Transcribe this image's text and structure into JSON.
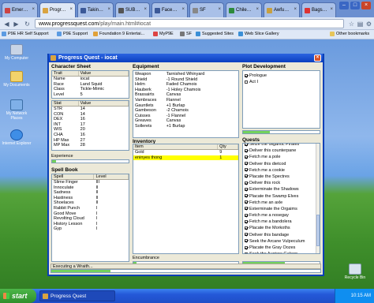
{
  "browser": {
    "tabs": [
      {
        "label": "Emer…"
      },
      {
        "label": "Progr…"
      },
      {
        "label": "Takin…"
      },
      {
        "label": "SUB…"
      },
      {
        "label": "Face…"
      },
      {
        "label": "SF"
      },
      {
        "label": "Chile…"
      },
      {
        "label": "Awfu…"
      },
      {
        "label": "Bags…"
      }
    ],
    "url_domain": "www.progressquest.com",
    "url_path": "/play/main.html#iocat",
    "bookmarks": [
      "P9E HR Self Support",
      "P9E Support",
      "Foundation 9 Entertai...",
      "MyP9E",
      "SF",
      "Suggested Sites",
      "Web Slice Gallery"
    ],
    "other_bookmarks": "Other bookmarks"
  },
  "desktop": {
    "icons": [
      "My Computer",
      "My Documents",
      "My Network Places",
      "Internet Explorer",
      "Recycle Bin"
    ]
  },
  "pq": {
    "title": "Progress Quest - iocat",
    "character_sheet": {
      "label": "Character Sheet",
      "trait_headers": [
        "Trait",
        "Value"
      ],
      "traits": [
        [
          "Name",
          "iocat"
        ],
        [
          "Race",
          "Land Squid"
        ],
        [
          "Class",
          "Tickle-Mimic"
        ],
        [
          "Level",
          "5"
        ]
      ],
      "stat_headers": [
        "Stat",
        "Value"
      ],
      "stats": [
        [
          "STR",
          "14"
        ],
        [
          "CON",
          "14"
        ],
        [
          "DEX",
          "16"
        ],
        [
          "INT",
          "17"
        ],
        [
          "WIS",
          "20"
        ],
        [
          "CHA",
          "16"
        ],
        [
          "HP Max",
          "27"
        ],
        [
          "MP Max",
          "28"
        ]
      ],
      "experience_label": "Experience",
      "experience_fraction": 0.05
    },
    "spell_book": {
      "label": "Spell Book",
      "headers": [
        "Spell",
        "Level"
      ],
      "spells": [
        [
          "Slime Finger",
          "III"
        ],
        [
          "Innoculate",
          "II"
        ],
        [
          "Sadness",
          "II"
        ],
        [
          "Hastiness",
          "II"
        ],
        [
          "Shoelaces",
          "II"
        ],
        [
          "Rabbit Punch",
          "I"
        ],
        [
          "Good Move",
          "I"
        ],
        [
          "Revolting Cloud",
          "I"
        ],
        [
          "History Lesson",
          "I"
        ],
        [
          "Gyp",
          "I"
        ]
      ]
    },
    "equipment": {
      "label": "Equipment",
      "items": [
        [
          "Weapon",
          "Tarnished Whinyard"
        ],
        [
          "Shield",
          "-1 Round Shield"
        ],
        [
          "Helm",
          "Faded Chamois"
        ],
        [
          "Hauberk",
          "-1 Holey Chamois"
        ],
        [
          "Brassairts",
          "Canvas"
        ],
        [
          "Vambraces",
          "Flannel"
        ],
        [
          "Gauntlets",
          "+1 Burlap"
        ],
        [
          "Gambeson",
          "-2 Chamois"
        ],
        [
          "Cuisses",
          "-1 Flannel"
        ],
        [
          "Greaves",
          "Canvas"
        ],
        [
          "Sollerets",
          "+1 Burlap"
        ]
      ]
    },
    "inventory": {
      "label": "Inventory",
      "headers": [
        "Item",
        "Qty"
      ],
      "items": [
        [
          "Gold",
          "9"
        ],
        [
          "eninyes thong",
          "1"
        ]
      ],
      "encumbrance_label": "Encumbrance",
      "encumbrance_fraction": 0.03
    },
    "plot": {
      "label": "Plot Development",
      "items": [
        {
          "label": "Prologue",
          "checked": true
        },
        {
          "label": "Act I",
          "checked": false
        }
      ],
      "progress_fraction": 0.35
    },
    "quests": {
      "label": "Quests",
      "items": [
        {
          "label": "Seize the Gigantic Pirates",
          "checked": true
        },
        {
          "label": "Deliver this counterpane",
          "checked": true
        },
        {
          "label": "Fetch me a pole",
          "checked": true
        },
        {
          "label": "Deliver this dietcod",
          "checked": true
        },
        {
          "label": "Fetch me a cookie",
          "checked": true
        },
        {
          "label": "Placate the Spectres",
          "checked": true
        },
        {
          "label": "Deliver this rock",
          "checked": true
        },
        {
          "label": "Exterminate the Shadows",
          "checked": true
        },
        {
          "label": "Placate the Swamp Elves",
          "checked": true
        },
        {
          "label": "Fetch me an axle",
          "checked": true
        },
        {
          "label": "Exterminate the Orgaims",
          "checked": true
        },
        {
          "label": "Fetch me a nosegay",
          "checked": true
        },
        {
          "label": "Fetch me a bandolera",
          "checked": true
        },
        {
          "label": "Placate the Morkoths",
          "checked": true
        },
        {
          "label": "Deliver this bandage",
          "checked": true
        },
        {
          "label": "Seek the Arcane Vulpeculum",
          "checked": true
        },
        {
          "label": "Placate the Gray Oozes",
          "checked": true
        },
        {
          "label": "Seek the Austere Galeon",
          "checked": true
        },
        {
          "label": "Fetch me a bunny",
          "checked": false
        }
      ],
      "progress_fraction": 0.55
    },
    "status": {
      "text": "Executing a Wraith...",
      "progress_fraction": 0.22
    }
  },
  "taskbar": {
    "start_label": "start",
    "task_label": "Progress Quest",
    "clock": "10:15 AM"
  }
}
